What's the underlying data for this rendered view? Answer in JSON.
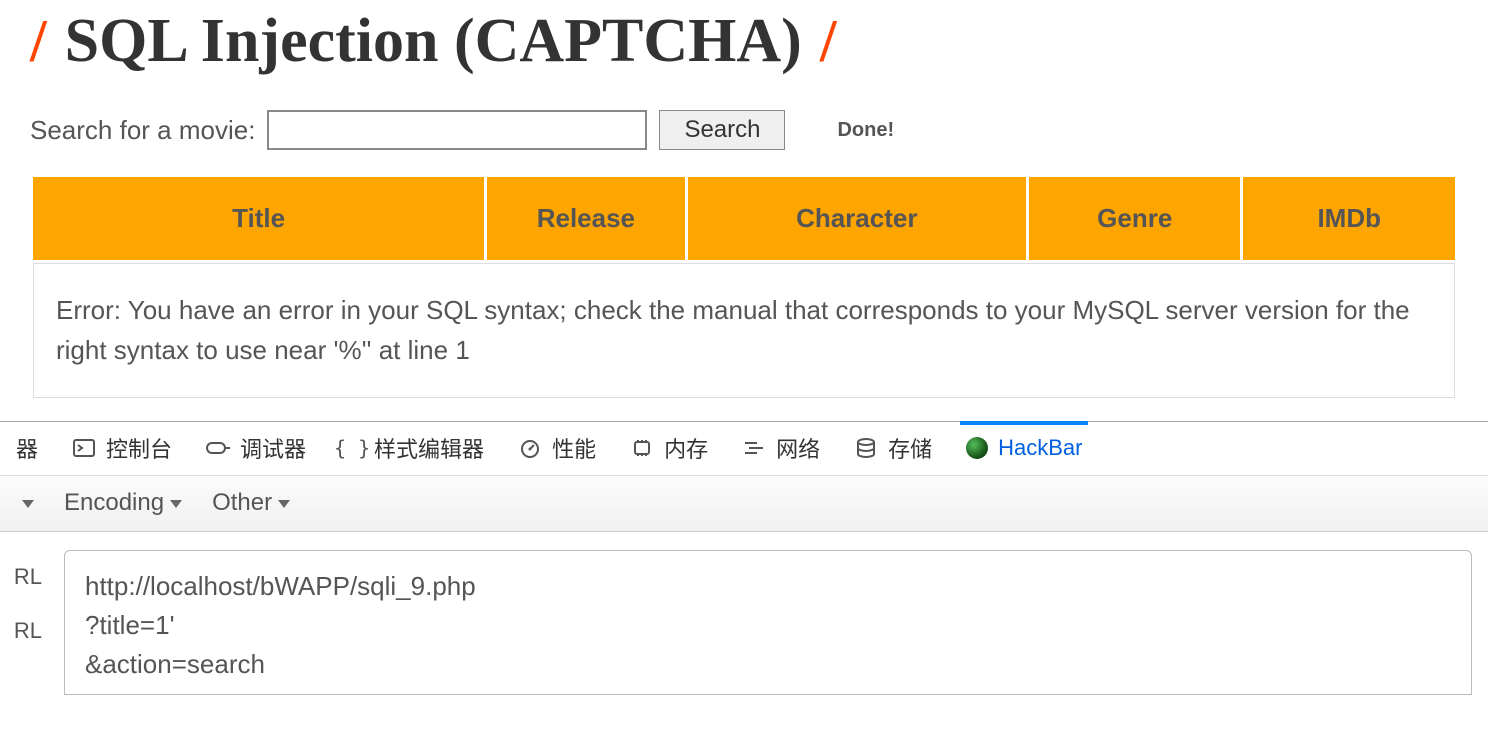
{
  "header": {
    "slash": "/",
    "title": "SQL Injection (CAPTCHA)"
  },
  "search": {
    "label": "Search for a movie:",
    "value": "",
    "button": "Search",
    "status": "Done!"
  },
  "table": {
    "headers": [
      "Title",
      "Release",
      "Character",
      "Genre",
      "IMDb"
    ],
    "error": "Error: You have an error in your SQL syntax; check the manual that corresponds to your MySQL server version for the right syntax to use near '%'' at line 1"
  },
  "devtools": {
    "partial_tab": "器",
    "tabs": {
      "console": "控制台",
      "debugger": "调试器",
      "style_editor": "样式编辑器",
      "performance": "性能",
      "memory": "内存",
      "network": "网络",
      "storage": "存储",
      "hackbar": "HackBar"
    },
    "toolbar": {
      "partial_dd": "",
      "encoding": "Encoding",
      "other": "Other"
    },
    "sidebar": {
      "rl1": "RL",
      "rl2": "RL"
    },
    "url_lines": [
      "http://localhost/bWAPP/sqli_9.php",
      "?title=1'",
      "&action=search"
    ]
  }
}
